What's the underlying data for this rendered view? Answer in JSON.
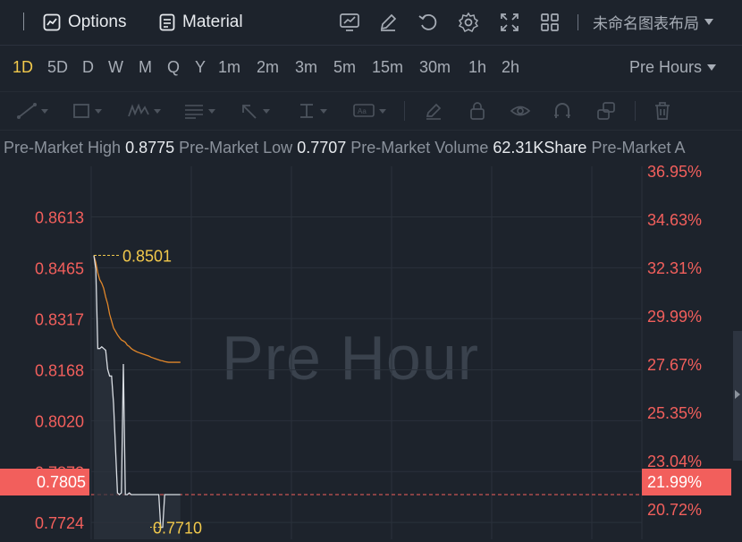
{
  "toolbar": {
    "options_label": "Options",
    "material_label": "Material",
    "layout_label": "未命名图表布局"
  },
  "periods": [
    "1D",
    "5D",
    "D",
    "W",
    "M",
    "Q",
    "Y",
    "1m",
    "2m",
    "3m",
    "5m",
    "15m",
    "30m",
    "1h",
    "2h"
  ],
  "active_period": "1D",
  "session_label": "Pre Hours",
  "info": {
    "high_label": "Pre-Market High",
    "high_value": "0.8775",
    "low_label": "Pre-Market Low",
    "low_value": "0.7707",
    "volume_label": "Pre-Market Volume",
    "volume_value": "62.31KShare",
    "amount_label": "Pre-Market A"
  },
  "watermark": "Pre Hour",
  "colors": {
    "accent": "#f2c94c",
    "down": "#f25f5c",
    "price_line": "#d9dde3",
    "avg_line": "#e0862a",
    "annotation": "#f2c94c"
  },
  "chart_data": {
    "type": "line",
    "y_left_ticks": [
      "0.8613",
      "0.8465",
      "0.8317",
      "0.8168",
      "0.8020",
      "0.7872",
      "0.7724"
    ],
    "y_right_ticks": [
      "36.95%",
      "34.63%",
      "32.31%",
      "29.99%",
      "27.67%",
      "25.35%",
      "23.04%",
      "20.72%"
    ],
    "ylim": [
      0.7675,
      0.876
    ],
    "current_price": "0.7805",
    "current_change": "21.99%",
    "max_label": "0.8501",
    "min_label": "0.7710",
    "x_index_range": [
      0,
      280
    ],
    "series": [
      {
        "values": [
          [
            0,
            0.8501
          ],
          [
            1,
            0.846
          ],
          [
            2,
            0.823
          ],
          [
            3,
            0.823
          ],
          [
            4,
            0.8235
          ],
          [
            5,
            0.823
          ],
          [
            6,
            0.8225
          ],
          [
            7,
            0.817
          ],
          [
            8,
            0.815
          ],
          [
            9,
            0.815
          ],
          [
            10,
            0.807
          ],
          [
            11,
            0.794
          ],
          [
            12,
            0.781
          ],
          [
            13,
            0.7805
          ],
          [
            14,
            0.781
          ],
          [
            15,
            0.8185
          ],
          [
            16,
            0.7805
          ],
          [
            17,
            0.7805
          ],
          [
            18,
            0.781
          ],
          [
            19,
            0.7805
          ],
          [
            20,
            0.7805
          ],
          [
            21,
            0.7805
          ],
          [
            22,
            0.7805
          ],
          [
            23,
            0.7805
          ],
          [
            24,
            0.7805
          ],
          [
            25,
            0.7805
          ],
          [
            26,
            0.7805
          ],
          [
            27,
            0.7805
          ],
          [
            28,
            0.7805
          ],
          [
            29,
            0.7805
          ],
          [
            30,
            0.7805
          ],
          [
            31,
            0.7805
          ],
          [
            32,
            0.7805
          ],
          [
            33,
            0.7805
          ],
          [
            34,
            0.771
          ],
          [
            35,
            0.771
          ],
          [
            36,
            0.7805
          ],
          [
            37,
            0.7805
          ],
          [
            38,
            0.7805
          ],
          [
            39,
            0.7805
          ],
          [
            40,
            0.7805
          ],
          [
            41,
            0.7805
          ],
          [
            42,
            0.7805
          ],
          [
            43,
            0.7805
          ],
          [
            44,
            0.7805
          ]
        ]
      },
      {
        "values": [
          [
            0,
            0.8501
          ],
          [
            1,
            0.848
          ],
          [
            2,
            0.845
          ],
          [
            3,
            0.843
          ],
          [
            4,
            0.842
          ],
          [
            5,
            0.8405
          ],
          [
            6,
            0.838
          ],
          [
            7,
            0.836
          ],
          [
            8,
            0.833
          ],
          [
            9,
            0.831
          ],
          [
            10,
            0.829
          ],
          [
            11,
            0.828
          ],
          [
            12,
            0.827
          ],
          [
            13,
            0.8262
          ],
          [
            14,
            0.8255
          ],
          [
            15,
            0.8252
          ],
          [
            16,
            0.8248
          ],
          [
            17,
            0.824
          ],
          [
            18,
            0.8236
          ],
          [
            19,
            0.823
          ],
          [
            20,
            0.8226
          ],
          [
            21,
            0.8223
          ],
          [
            22,
            0.822
          ],
          [
            23,
            0.8218
          ],
          [
            24,
            0.8216
          ],
          [
            25,
            0.8214
          ],
          [
            26,
            0.8212
          ],
          [
            27,
            0.821
          ],
          [
            28,
            0.8208
          ],
          [
            29,
            0.8205
          ],
          [
            30,
            0.8203
          ],
          [
            31,
            0.8201
          ],
          [
            32,
            0.8199
          ],
          [
            33,
            0.8197
          ],
          [
            34,
            0.8195
          ],
          [
            35,
            0.8194
          ],
          [
            36,
            0.8192
          ],
          [
            37,
            0.8191
          ],
          [
            38,
            0.819
          ],
          [
            39,
            0.819
          ],
          [
            40,
            0.819
          ],
          [
            41,
            0.819
          ],
          [
            42,
            0.819
          ],
          [
            43,
            0.819
          ],
          [
            44,
            0.819
          ]
        ]
      }
    ]
  }
}
